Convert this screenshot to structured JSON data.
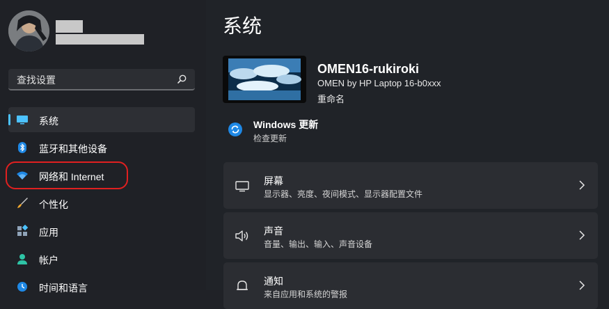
{
  "search": {
    "placeholder": "查找设置"
  },
  "sidebar": {
    "items": [
      {
        "label": "系统",
        "icon": "monitor-icon",
        "active": true
      },
      {
        "label": "蓝牙和其他设备",
        "icon": "bluetooth-icon"
      },
      {
        "label": "网络和 Internet",
        "icon": "wifi-icon"
      },
      {
        "label": "个性化",
        "icon": "brush-icon"
      },
      {
        "label": "应用",
        "icon": "apps-icon"
      },
      {
        "label": "帐户",
        "icon": "person-icon"
      },
      {
        "label": "时间和语言",
        "icon": "globe-clock-icon"
      }
    ]
  },
  "main": {
    "title": "系统",
    "device": {
      "name": "OMEN16-rukiroki",
      "model": "OMEN by HP Laptop 16-b0xxx",
      "rename": "重命名"
    },
    "windows_update": {
      "title": "Windows 更新",
      "subtitle": "检查更新"
    },
    "cards": [
      {
        "title": "屏幕",
        "subtitle": "显示器、亮度、夜间模式、显示器配置文件",
        "icon": "display-icon"
      },
      {
        "title": "声音",
        "subtitle": "音量、输出、输入、声音设备",
        "icon": "speaker-icon"
      },
      {
        "title": "通知",
        "subtitle": "来自应用和系统的警报",
        "icon": "bell-icon"
      }
    ]
  },
  "colors": {
    "accent": "#4cc2ff",
    "annotation": "#e02020",
    "background": "#202227",
    "card": "#2b2d32"
  }
}
